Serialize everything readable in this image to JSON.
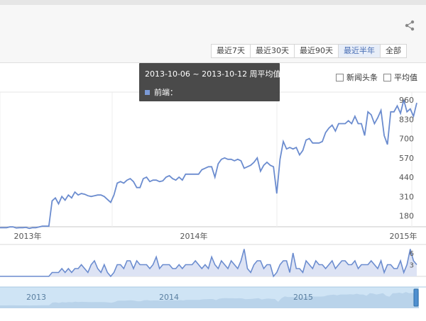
{
  "range_buttons": [
    "最近7天",
    "最近30天",
    "最近90天",
    "最近半年",
    "全部"
  ],
  "active_range_index": 3,
  "legend": {
    "news_label": "新闻头条",
    "average_label": "平均值"
  },
  "tooltip": {
    "date_range": "2013-10-06 ~ 2013-10-12 周平均值",
    "series_label": "前端："
  },
  "colors": {
    "line": "#6b8ccf",
    "area": "#dde3f4",
    "navigator": "#cfe4f5",
    "tooltip_bg": "#404040"
  },
  "main_chart": {
    "y_ticks": [
      180,
      310,
      440,
      570,
      700,
      830,
      960
    ],
    "x_labels": [
      "2013年",
      "2014年",
      "2015年"
    ]
  },
  "news_chart": {
    "y_ticks": [
      3,
      6
    ]
  },
  "navigator": {
    "x_labels": [
      "2013",
      "2014",
      "2015"
    ]
  },
  "chart_data": {
    "type": "line",
    "title": "",
    "y_ticks": [
      180,
      310,
      440,
      570,
      700,
      830,
      960
    ],
    "x_tick_labels": [
      "2013年",
      "2014年",
      "2015年"
    ],
    "series": [
      {
        "values": [
          100,
          100,
          100,
          105,
          105,
          98,
          100,
          100,
          102,
          95,
          100,
          100,
          105,
          110,
          110,
          110,
          280,
          300,
          260,
          310,
          285,
          320,
          300,
          340,
          320,
          330,
          325,
          315,
          310,
          315,
          320,
          320,
          310,
          290,
          270,
          320,
          400,
          410,
          400,
          420,
          430,
          410,
          370,
          370,
          430,
          440,
          410,
          420,
          420,
          410,
          415,
          440,
          450,
          430,
          420,
          440,
          420,
          460,
          460,
          460,
          460,
          460,
          490,
          500,
          510,
          510,
          440,
          530,
          560,
          570,
          560,
          560,
          550,
          560,
          550,
          500,
          510,
          520,
          540,
          570,
          480,
          520,
          540,
          520,
          510,
          330,
          560,
          680,
          630,
          640,
          630,
          640,
          590,
          620,
          690,
          700,
          670,
          670,
          670,
          680,
          740,
          770,
          790,
          750,
          800,
          800,
          800,
          820,
          800,
          850,
          800,
          800,
          720,
          880,
          860,
          800,
          840,
          890,
          720,
          660,
          880,
          880,
          920,
          870,
          960,
          880,
          900,
          850,
          940
        ]
      }
    ],
    "news_values": [
      0,
      0,
      0,
      0,
      0,
      0,
      0,
      0,
      0,
      0,
      0,
      0,
      0,
      0,
      0,
      0,
      1,
      1,
      1,
      2,
      1,
      2,
      1,
      2,
      2,
      3,
      2,
      1,
      3,
      4,
      2,
      1,
      3,
      1,
      0,
      1,
      3,
      3,
      2,
      4,
      4,
      2,
      4,
      3,
      3,
      3,
      2,
      3,
      5,
      2,
      3,
      3,
      3,
      2,
      2,
      3,
      2,
      3,
      3,
      3,
      4,
      3,
      2,
      3,
      2,
      5,
      3,
      2,
      4,
      3,
      2,
      4,
      3,
      2,
      4,
      7,
      2,
      1,
      3,
      4,
      4,
      2,
      3,
      3,
      0,
      1,
      3,
      4,
      4,
      1,
      6,
      2,
      2,
      1,
      4,
      3,
      2,
      4,
      3,
      3,
      2,
      3,
      4,
      2,
      3,
      4,
      4,
      3,
      3,
      4,
      2,
      3,
      3,
      3,
      4,
      3,
      2,
      4,
      1,
      3,
      3,
      2,
      2,
      4,
      1,
      3,
      7,
      4,
      3
    ]
  }
}
